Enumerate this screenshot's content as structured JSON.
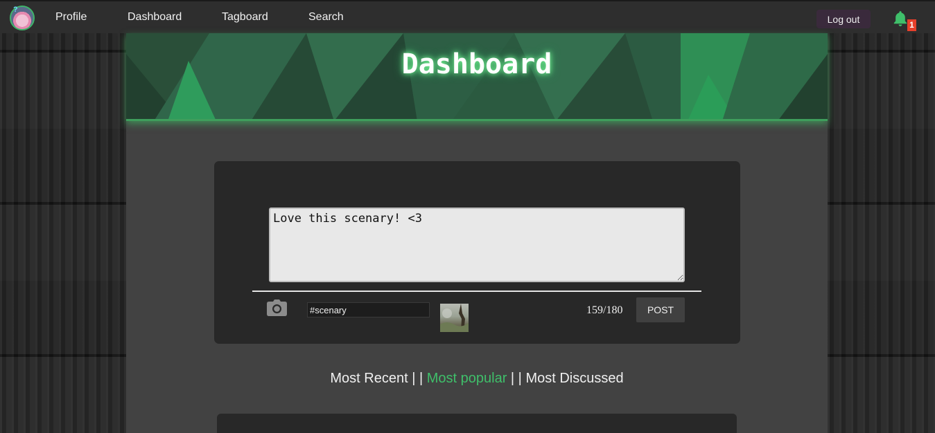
{
  "nav": {
    "links": [
      "Profile",
      "Dashboard",
      "Tagboard",
      "Search"
    ],
    "logout_label": "Log out",
    "notification_count": "1"
  },
  "banner": {
    "title": "Dashboard"
  },
  "composer": {
    "post_text": "Love this scenary! <3",
    "tag_value": "#scenary",
    "char_count": "159/180",
    "post_label": "POST"
  },
  "sort": {
    "options": [
      "Most Recent",
      "Most popular",
      "Most Discussed"
    ],
    "separator": "| |",
    "active": "Most popular"
  },
  "colors": {
    "accent": "#3fbf6a",
    "badge": "#e7402b",
    "panel": "#282828",
    "main_bg": "#424242"
  }
}
